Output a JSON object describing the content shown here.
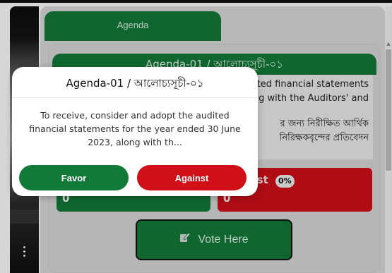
{
  "tab": {
    "label": "Agenda"
  },
  "agenda": {
    "title": "Agenda-01 / আলোচ্যসূচী-০১",
    "text_en": "ted financial statements\ng with the Auditors' and",
    "text_bn": "র জন্য নিরীক্ষিত আর্থিক\nনিরিক্ষকবৃন্দের প্রতিবেদন"
  },
  "results": {
    "favor": {
      "count": "0"
    },
    "against": {
      "label": "nst",
      "percent": "0%",
      "count": "0"
    }
  },
  "vote_button": {
    "label": "Vote Here",
    "icon": "edit-icon"
  },
  "modal": {
    "title": "Agenda-01 / আলোচ্যসূচী-০১",
    "body": "To receive, consider and adopt the audited financial statements for the year ended 30 June 2023, along with th...",
    "favor_label": "Favor",
    "against_label": "Against"
  },
  "colors": {
    "green": "#127a38",
    "red": "#d10f18"
  }
}
